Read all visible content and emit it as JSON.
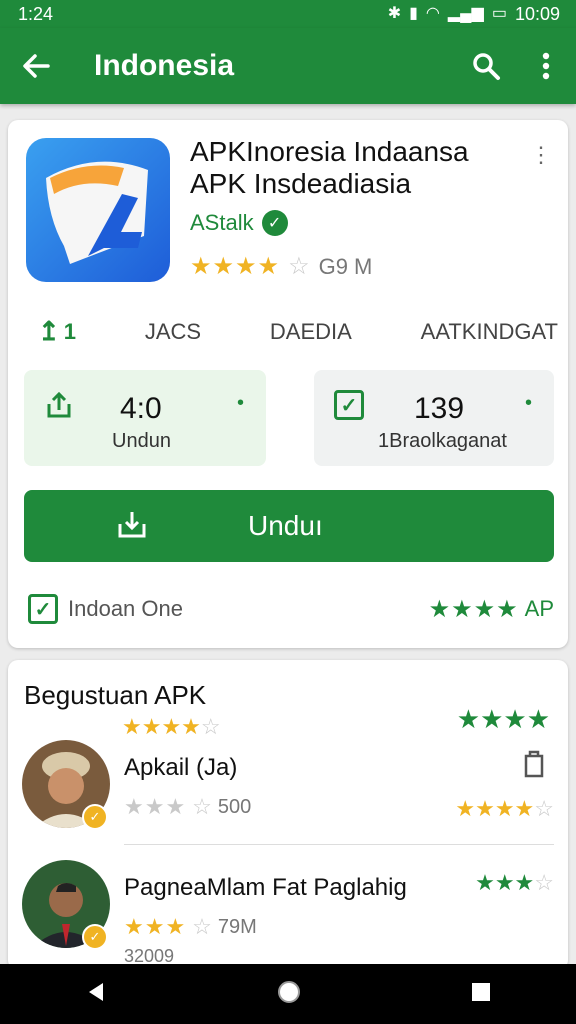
{
  "status_bar": {
    "time_left": "1:24",
    "time_right": "10:09"
  },
  "app_bar": {
    "title": "Indonesia"
  },
  "app": {
    "title_line1": "APKInoresia Indaansa",
    "title_line2": "APK Insdeadiasia",
    "developer": "AStalk",
    "rating_stars": "★★★★",
    "rating_stars_empty": "☆",
    "size": "G9 M"
  },
  "tabs": [
    "1",
    "JACS",
    "DAEDIA",
    "AATKINDGAT"
  ],
  "stats": {
    "left": {
      "value": "4:0",
      "label": "Undun"
    },
    "right": {
      "value": "139",
      "label": "1Braolkaganat"
    }
  },
  "install_button": {
    "label": "Unduı"
  },
  "footer": {
    "label": "Indoan One",
    "rating_text": "AP",
    "stars": "★★★★"
  },
  "reviews_section": {
    "title": "Begustuan APK",
    "stars_left": "★★★★",
    "stars_left_empty": "☆",
    "stars_right": "★★★★"
  },
  "reviews": [
    {
      "name": "Apkail (Ja)",
      "stars": "★★★",
      "stars_empty": "☆",
      "count": "500",
      "right_stars": "★★★★",
      "right_stars_empty": "☆"
    },
    {
      "name": "PagneaMlam Fat Paglahig",
      "stars": "★★★",
      "stars_empty": "☆",
      "count": "79M",
      "extra": "32009",
      "right_stars": "★★★",
      "right_stars_empty": "☆"
    }
  ],
  "colors": {
    "primary": "#1f8a3b",
    "star": "#f0b323",
    "background": "#ececec"
  }
}
